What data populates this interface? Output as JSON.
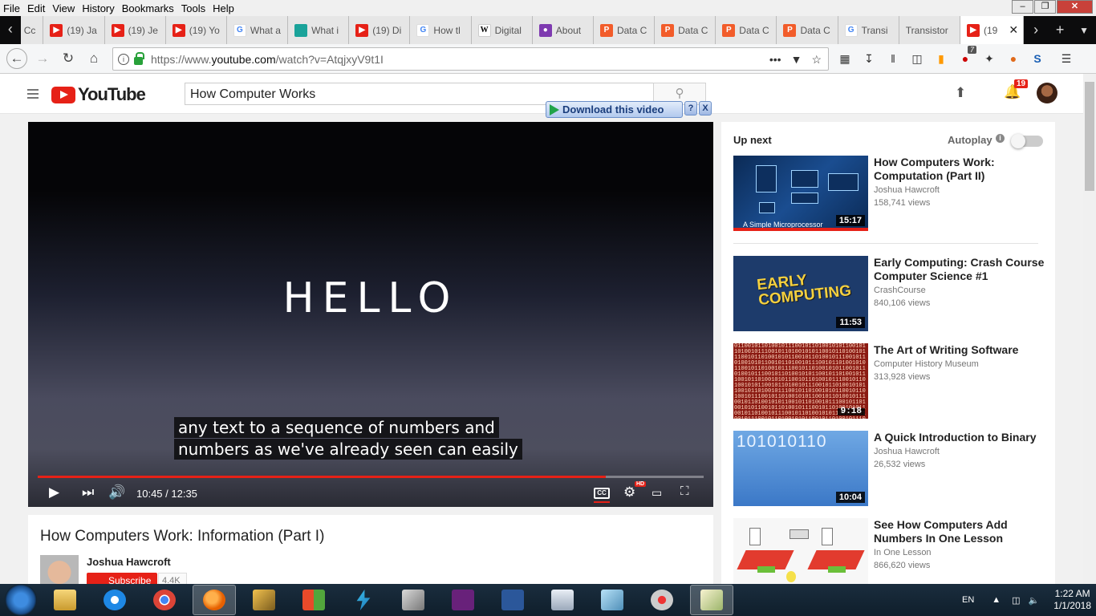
{
  "menu": [
    "File",
    "Edit",
    "View",
    "History",
    "Bookmarks",
    "Tools",
    "Help"
  ],
  "tabs": [
    {
      "title": "(19) Ja",
      "icon": "youtube-icon"
    },
    {
      "title": "(19) Je",
      "icon": "youtube-icon"
    },
    {
      "title": "(19) Yo",
      "icon": "youtube-icon"
    },
    {
      "title": "What a",
      "icon": "google-icon"
    },
    {
      "title": "What i",
      "icon": "teal-icon"
    },
    {
      "title": "(19) Di",
      "icon": "youtube-icon"
    },
    {
      "title": "How tl",
      "icon": "google-icon"
    },
    {
      "title": "Digital",
      "icon": "wikipedia-icon"
    },
    {
      "title": "About",
      "icon": "about-icon"
    },
    {
      "title": "Data C",
      "icon": "p-icon"
    },
    {
      "title": "Data C",
      "icon": "p-icon"
    },
    {
      "title": "Data C",
      "icon": "p-icon"
    },
    {
      "title": "Data C",
      "icon": "p-icon"
    },
    {
      "title": "Transi",
      "icon": "google-icon"
    },
    {
      "title": "Transistor",
      "icon": ""
    },
    {
      "title": "(19",
      "icon": "youtube-icon"
    }
  ],
  "first_tab_partial": "Cc",
  "url": {
    "prefix": "https://www.",
    "domain": "youtube.com",
    "path": "/watch?v=AtqjxyV9t1I"
  },
  "toolbar_badge": "7",
  "youtube": {
    "logo_text": "YouTube",
    "search_value": "How Computer Works",
    "notif_count": "19",
    "download_label": "Download this video",
    "download_help": "?",
    "download_close": "X"
  },
  "player": {
    "hello": "HELLO",
    "caption_line1": "any text to a sequence of numbers and",
    "caption_line2": "numbers as we've already seen can easily",
    "time": "10:45 / 12:35",
    "progress": 0.853,
    "cc_label": "CC",
    "hd_label": "HD"
  },
  "video": {
    "title": "How Computers Work: Information (Part I)",
    "channel": "Joshua Hawcroft",
    "subscribe": "Subscribe",
    "sub_count": "4.4K"
  },
  "sidebar": {
    "up_next": "Up next",
    "autoplay": "Autoplay",
    "items": [
      {
        "title": "How Computers Work: Computation (Part II)",
        "channel": "Joshua Hawcroft",
        "views": "158,741 views",
        "duration": "15:17",
        "thumb_label": "A Simple Microprocessor"
      },
      {
        "title": "Early Computing: Crash Course Computer Science #1",
        "channel": "CrashCourse",
        "views": "840,106 views",
        "duration": "11:53",
        "thumb_label": "EARLY COMPUTING"
      },
      {
        "title": "The Art of Writing Software",
        "channel": "Computer History Museum",
        "views": "313,928 views",
        "duration": "9:18"
      },
      {
        "title": "A Quick Introduction to Binary",
        "channel": "Joshua Hawcroft",
        "views": "26,532 views",
        "duration": "10:04",
        "thumb_label": "101010110"
      },
      {
        "title": "See How Computers Add Numbers In One Lesson",
        "channel": "In One Lesson",
        "views": "866,620 views",
        "duration": ""
      }
    ]
  },
  "tray": {
    "lang": "EN",
    "time": "1:22 AM",
    "date": "1/1/2018"
  }
}
